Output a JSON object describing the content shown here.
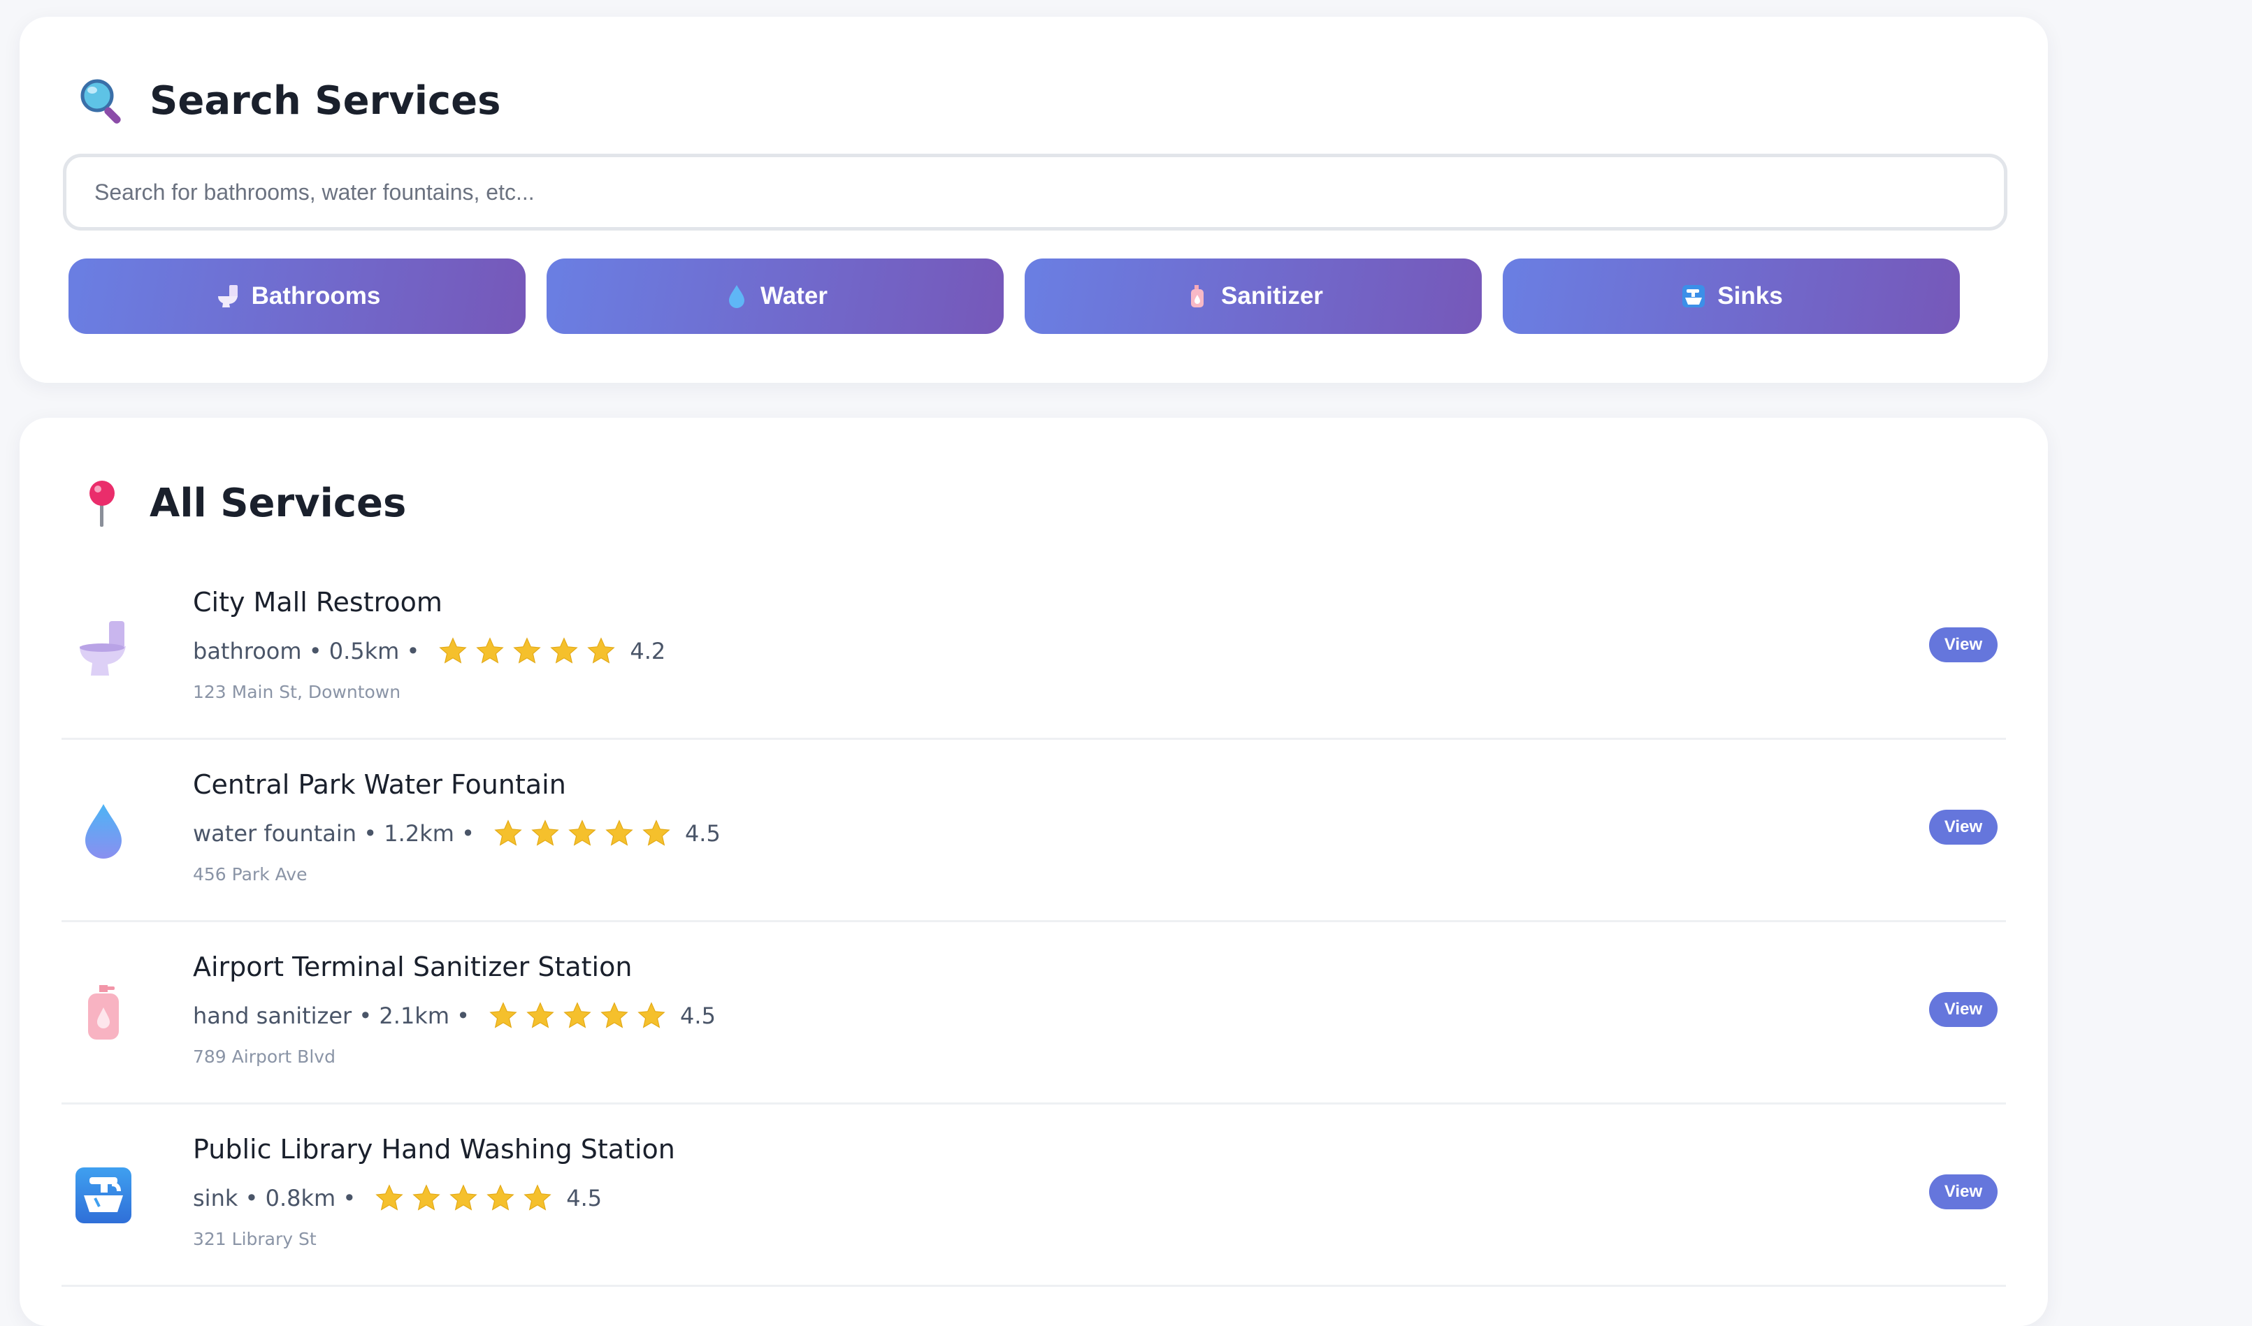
{
  "search": {
    "title": "Search Services",
    "title_icon": "magnifier-icon",
    "placeholder": "Search for bathrooms, water fountains, etc...",
    "filters": [
      {
        "label": "Bathrooms",
        "icon": "toilet-icon"
      },
      {
        "label": "Water",
        "icon": "droplet-icon"
      },
      {
        "label": "Sanitizer",
        "icon": "sanitizer-bottle-icon"
      },
      {
        "label": "Sinks",
        "icon": "faucet-icon"
      }
    ]
  },
  "services": {
    "title": "All Services",
    "title_icon": "map-pin-icon",
    "view_label": "View",
    "items": [
      {
        "name": "City Mall Restroom",
        "type": "bathroom",
        "distance": "0.5km",
        "rating": "4.2",
        "address": "123 Main St, Downtown",
        "icon": "toilet-icon",
        "stars": 5
      },
      {
        "name": "Central Park Water Fountain",
        "type": "water fountain",
        "distance": "1.2km",
        "rating": "4.5",
        "address": "456 Park Ave",
        "icon": "droplet-icon",
        "stars": 5
      },
      {
        "name": "Airport Terminal Sanitizer Station",
        "type": "hand sanitizer",
        "distance": "2.1km",
        "rating": "4.5",
        "address": "789 Airport Blvd",
        "icon": "sanitizer-bottle-icon",
        "stars": 5
      },
      {
        "name": "Public Library Hand Washing Station",
        "type": "sink",
        "distance": "0.8km",
        "rating": "4.5",
        "address": "321 Library St",
        "icon": "faucet-icon",
        "stars": 5
      }
    ]
  },
  "colors": {
    "accent_start": "#6a7fe3",
    "accent_end": "#7658b9",
    "view_button": "#6576dc",
    "star": "#f5c02c"
  }
}
